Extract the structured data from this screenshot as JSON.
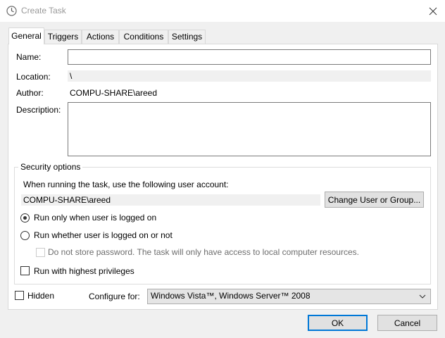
{
  "window": {
    "title": "Create Task",
    "app_icon": "task-scheduler-clock-icon",
    "close_icon": "close-icon"
  },
  "tabs": [
    {
      "label": "General",
      "active": true
    },
    {
      "label": "Triggers"
    },
    {
      "label": "Actions"
    },
    {
      "label": "Conditions"
    },
    {
      "label": "Settings"
    }
  ],
  "general": {
    "name_label": "Name:",
    "name_value": "",
    "location_label": "Location:",
    "location_value": "\\",
    "author_label": "Author:",
    "author_value": "COMPU-SHARE\\areed",
    "description_label": "Description:",
    "description_value": ""
  },
  "security": {
    "title": "Security options",
    "account_prompt": "When running the task, use the following user account:",
    "account_value": "COMPU-SHARE\\areed",
    "change_button": "Change User or Group...",
    "run_logged_on": "Run only when user is logged on",
    "run_logged_on_selected": true,
    "run_whether": "Run whether user is logged on or not",
    "run_whether_selected": false,
    "no_store_password": "Do not store password.  The task will only have access to local computer resources.",
    "no_store_password_checked": false,
    "highest_privileges": "Run with highest privileges",
    "highest_privileges_checked": false
  },
  "footer": {
    "hidden_label": "Hidden",
    "hidden_checked": false,
    "configure_label": "Configure for:",
    "configure_value": "Windows Vista™, Windows Server™ 2008"
  },
  "buttons": {
    "ok": "OK",
    "cancel": "Cancel"
  },
  "colors": {
    "accent": "#0078d7",
    "window_bg": "#f0f0f0",
    "page_bg": "#ffffff"
  }
}
